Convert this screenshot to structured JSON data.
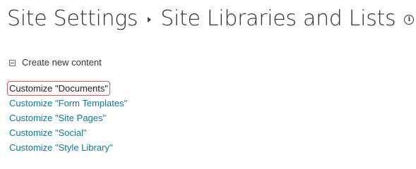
{
  "breadcrumb": {
    "parent": "Site Settings",
    "current": "Site Libraries and Lists",
    "separator_icon": "triangle-right-icon",
    "info_icon": "info-icon",
    "info_glyph": "i"
  },
  "section": {
    "title": "Create new content",
    "icon": "collapse-icon"
  },
  "links": [
    {
      "label": "Customize \"Documents\"",
      "highlighted": true
    },
    {
      "label": "Customize \"Form Templates\""
    },
    {
      "label": "Customize \"Site Pages\""
    },
    {
      "label": "Customize \"Social\""
    },
    {
      "label": "Customize \"Style Library\""
    }
  ],
  "colors": {
    "link": "#0f7a96",
    "highlight_border": "#e0565b",
    "title_text": "#333333"
  }
}
